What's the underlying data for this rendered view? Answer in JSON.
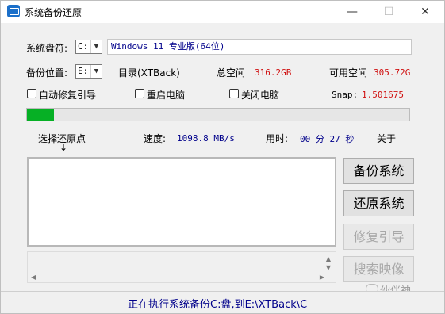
{
  "window": {
    "title": "系统备份还原",
    "controls": {
      "minimize": "—",
      "maximize": "☐",
      "close": "✕"
    }
  },
  "system_disk": {
    "label": "系统盘符:",
    "value": "C:",
    "os_name": "Windows 11 专业版(64位)"
  },
  "backup_location": {
    "label": "备份位置:",
    "value": "E:",
    "dir": "目录(XTBack)",
    "total_space_label": "总空间",
    "total_space_value": "316.2GB",
    "free_space_label": "可用空间",
    "free_space_value": "305.72G"
  },
  "options": [
    {
      "label": "自动修复引导",
      "checked": false
    },
    {
      "label": "重启电脑",
      "checked": false
    },
    {
      "label": "关闭电脑",
      "checked": false
    }
  ],
  "snap": {
    "label": "Snap:",
    "value": "1.501675"
  },
  "progress": {
    "percent": 7
  },
  "stats": {
    "restore_point_label": "选择还原点",
    "arrow": "↓",
    "speed_label": "速度:",
    "speed_value": "1098.8 MB/s",
    "time_label": "用时:",
    "time_value": "00 分 27 秒",
    "about_label": "关于"
  },
  "buttons": {
    "backup": "备份系统",
    "restore": "还原系统",
    "repair_boot": "修复引导",
    "search_image": "搜索映像"
  },
  "watermark": "伙伴神",
  "status": "正在执行系统备份C:盘,到E:\\XTBack\\C"
}
